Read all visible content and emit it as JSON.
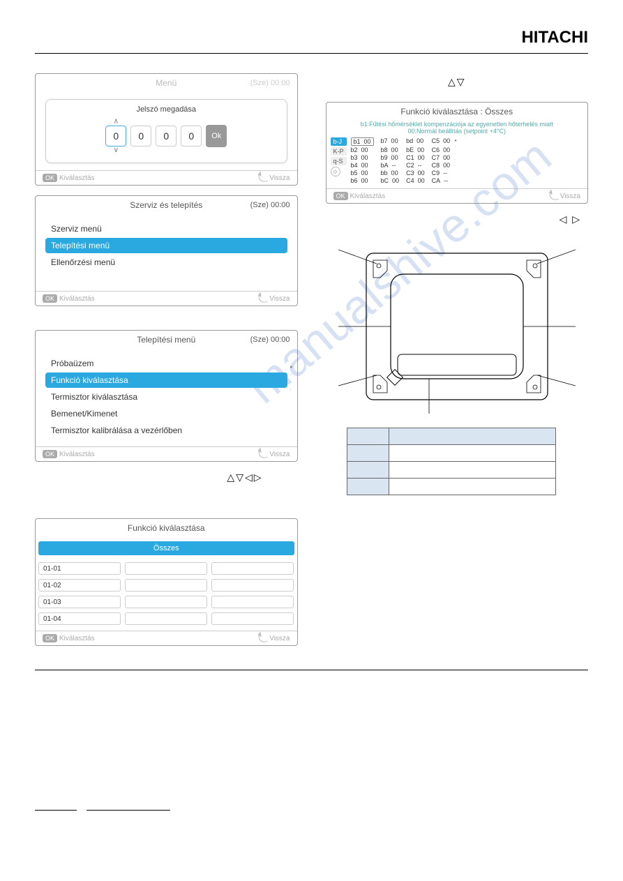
{
  "brand": "HITACHI",
  "watermark": "manualshive.com",
  "panel1": {
    "hdr": "Menü",
    "time": "(Sze) 00:00",
    "pwd_title": "Jelszó megadása",
    "digits": [
      "0",
      "0",
      "0",
      "0"
    ],
    "ok": "Ok",
    "foot_ok": "OK",
    "foot_sel": "Kiválasztás",
    "foot_back": "Vissza"
  },
  "panel2": {
    "hdr": "Szerviz és telepítés",
    "time": "(Sze) 00:00",
    "items": [
      "Szerviz menü",
      "Telepítési menü",
      "Ellenőrzési menü"
    ],
    "foot_ok": "OK",
    "foot_sel": "Kiválasztás",
    "foot_back": "Vissza"
  },
  "panel3": {
    "hdr": "Telepítési menü",
    "time": "(Sze) 00:00",
    "items": [
      "Próbaüzem",
      "Funkció kiválasztása",
      "Termisztor kiválasztása",
      "Bemenet/Kimenet",
      "Termisztor kalibrálása a vezérlőben"
    ],
    "foot_ok": "OK",
    "foot_sel": "Kiválasztás",
    "foot_back": "Vissza"
  },
  "arrows1": "△▽◁▷",
  "panel4": {
    "hdr": "Funkció kiválasztása",
    "all": "Összes",
    "cells": [
      "01-01",
      "",
      "",
      "01-02",
      "",
      "",
      "01-03",
      "",
      "",
      "01-04",
      "",
      ""
    ],
    "foot_ok": "OK",
    "foot_sel": "Kiválasztás",
    "foot_back": "Vissza"
  },
  "arrows_top": "△▽",
  "panel5": {
    "hdr": "Funkció kiválasztása : Összes",
    "sub1": "b1:Fűtési hőmérséklet kompenzációja az egyenetlen hőterhelés miatt",
    "sub2": "00:Normál beállítás (setpoint +4°C)",
    "tabs": [
      "b-J",
      "K-P",
      "q-S"
    ],
    "rows": [
      [
        "b1  00",
        "b7  00",
        "bd  00",
        "C5  00"
      ],
      [
        "b2  00",
        "b8  00",
        "bE  00",
        "C6  00"
      ],
      [
        "b3  00",
        "b9  00",
        "C1  00",
        "C7  00"
      ],
      [
        "b4  00",
        "bA  --",
        "C2  --",
        "C8  00"
      ],
      [
        "b5  00",
        "bb  00",
        "C3  00",
        "C9  --"
      ],
      [
        "b6  00",
        "bC  00",
        "C4  00",
        "CA  --"
      ]
    ],
    "foot_ok": "OK",
    "foot_sel": "Kiválasztás",
    "foot_back": "Vissza"
  },
  "arrows_right": "◁ ▷"
}
